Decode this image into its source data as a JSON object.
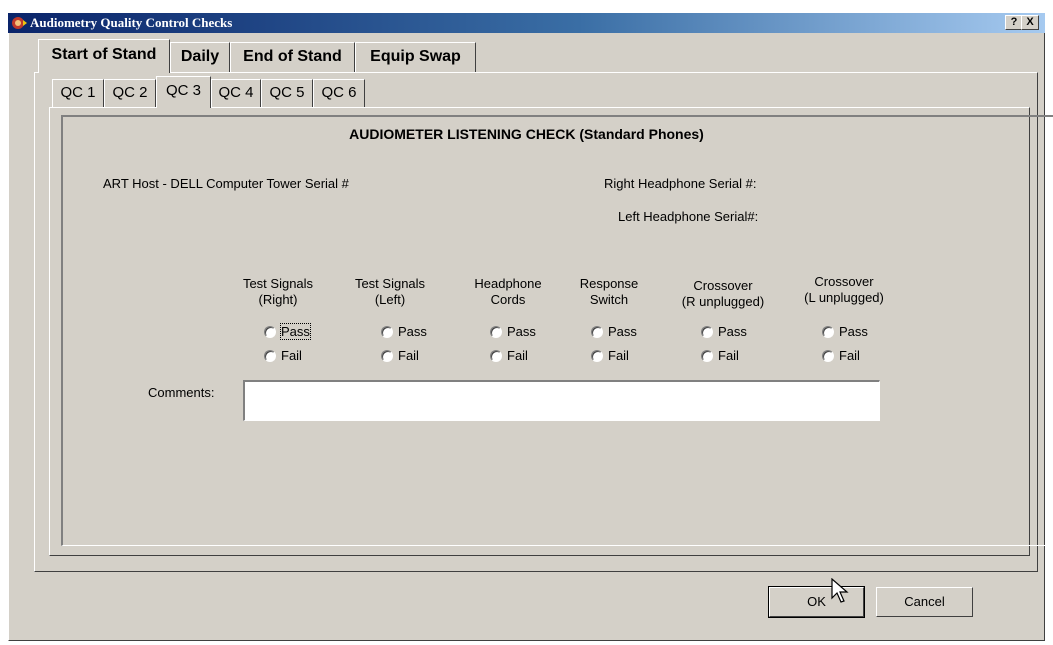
{
  "window": {
    "title": "Audiometry Quality Control Checks",
    "help_label": "?",
    "close_label": "X"
  },
  "top_tabs": [
    {
      "label": "Start of Stand",
      "active": true
    },
    {
      "label": "Daily",
      "active": false
    },
    {
      "label": "End of Stand",
      "active": false
    },
    {
      "label": "Equip Swap",
      "active": false
    }
  ],
  "sub_tabs": [
    {
      "label": "QC 1",
      "active": false
    },
    {
      "label": "QC 2",
      "active": false
    },
    {
      "label": "QC 3",
      "active": true
    },
    {
      "label": "QC 4",
      "active": false
    },
    {
      "label": "QC 5",
      "active": false
    },
    {
      "label": "QC 6",
      "active": false
    }
  ],
  "panel": {
    "heading": "AUDIOMETER LISTENING CHECK (Standard Phones)",
    "host_serial_label": "ART Host - DELL Computer Tower Serial #",
    "right_serial_label": "Right Headphone Serial #:",
    "left_serial_label": "Left Headphone Serial#:",
    "columns": [
      {
        "line1": "Test Signals",
        "line2": "(Right)"
      },
      {
        "line1": "Test Signals",
        "line2": "(Left)"
      },
      {
        "line1": "Headphone",
        "line2": "Cords"
      },
      {
        "line1": "Response",
        "line2": "Switch"
      },
      {
        "line1": "Crossover",
        "line2": "(R unplugged)"
      },
      {
        "line1": "Crossover",
        "line2": "(L unplugged)"
      }
    ],
    "pass_label": "Pass",
    "fail_label": "Fail",
    "comments_label": "Comments:",
    "comments_value": ""
  },
  "buttons": {
    "ok_label": "OK",
    "cancel_label": "Cancel"
  }
}
